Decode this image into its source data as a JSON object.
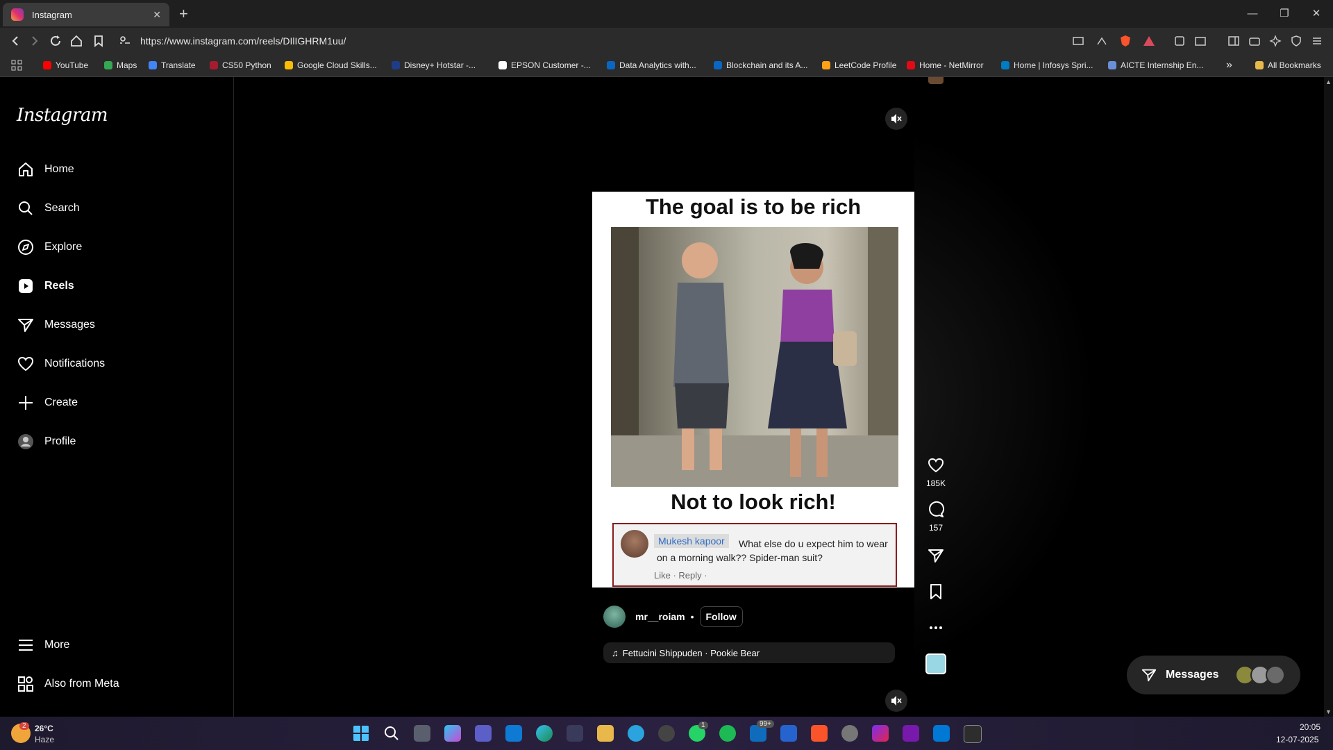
{
  "browser": {
    "tab_title": "Instagram",
    "tab_close": "✕",
    "new_tab": "+",
    "url": "https://www.instagram.com/reels/DIlIGHRM1uu/",
    "bookmarks": [
      {
        "label": "YouTube",
        "color": "#ff0000"
      },
      {
        "label": "Maps",
        "color": "#34a853"
      },
      {
        "label": "Translate",
        "color": "#4285f4"
      },
      {
        "label": "CS50 Python",
        "color": "#a51c30"
      },
      {
        "label": "Google Cloud Skills...",
        "color": "#fbbc05"
      },
      {
        "label": "Disney+ Hotstar -...",
        "color": "#1f3c88"
      },
      {
        "label": "EPSON Customer -...",
        "color": "#ffffff"
      },
      {
        "label": "Data Analytics with...",
        "color": "#0a66c2"
      },
      {
        "label": "Blockchain and its A...",
        "color": "#0a66c2"
      },
      {
        "label": "LeetCode Profile",
        "color": "#ffa116"
      },
      {
        "label": "Home - NetMirror",
        "color": "#e50914"
      },
      {
        "label": "Home | Infosys Spri...",
        "color": "#007cc3"
      },
      {
        "label": "AICTE Internship En...",
        "color": "#6a8fd6"
      }
    ],
    "all_bookmarks": "All Bookmarks",
    "overflow": "»"
  },
  "sidebar": {
    "logo": "Instagram",
    "items": [
      {
        "label": "Home",
        "icon": "home-icon"
      },
      {
        "label": "Search",
        "icon": "search-icon"
      },
      {
        "label": "Explore",
        "icon": "compass-icon"
      },
      {
        "label": "Reels",
        "icon": "reels-icon",
        "active": true
      },
      {
        "label": "Messages",
        "icon": "send-icon"
      },
      {
        "label": "Notifications",
        "icon": "heart-icon"
      },
      {
        "label": "Create",
        "icon": "plus-icon"
      },
      {
        "label": "Profile",
        "icon": "avatar-icon"
      }
    ],
    "bottom": [
      {
        "label": "More",
        "icon": "menu-icon"
      },
      {
        "label": "Also from Meta",
        "icon": "meta-grid-icon"
      }
    ]
  },
  "reel": {
    "meme_top": "The goal is to be rich",
    "meme_bottom": "Not to look rich!",
    "comment": {
      "name": "Mukesh kapoor",
      "text": "What else do u expect him to wear on a morning walk?? Spider-man suit?",
      "actions": "Like · Reply ·"
    },
    "author": "mr__roiam",
    "separator": "•",
    "follow": "Follow",
    "audio": "Fettucini Shippuden · Pookie Bear",
    "likes": "185K",
    "comments": "157"
  },
  "messages_pill": {
    "label": "Messages"
  },
  "taskbar": {
    "weather_temp": "26°C",
    "weather_desc": "Haze",
    "weather_badge": "2",
    "time": "20:05",
    "date": "12-07-2025",
    "badge_whatsapp": "1",
    "badge_mail": "99+"
  }
}
